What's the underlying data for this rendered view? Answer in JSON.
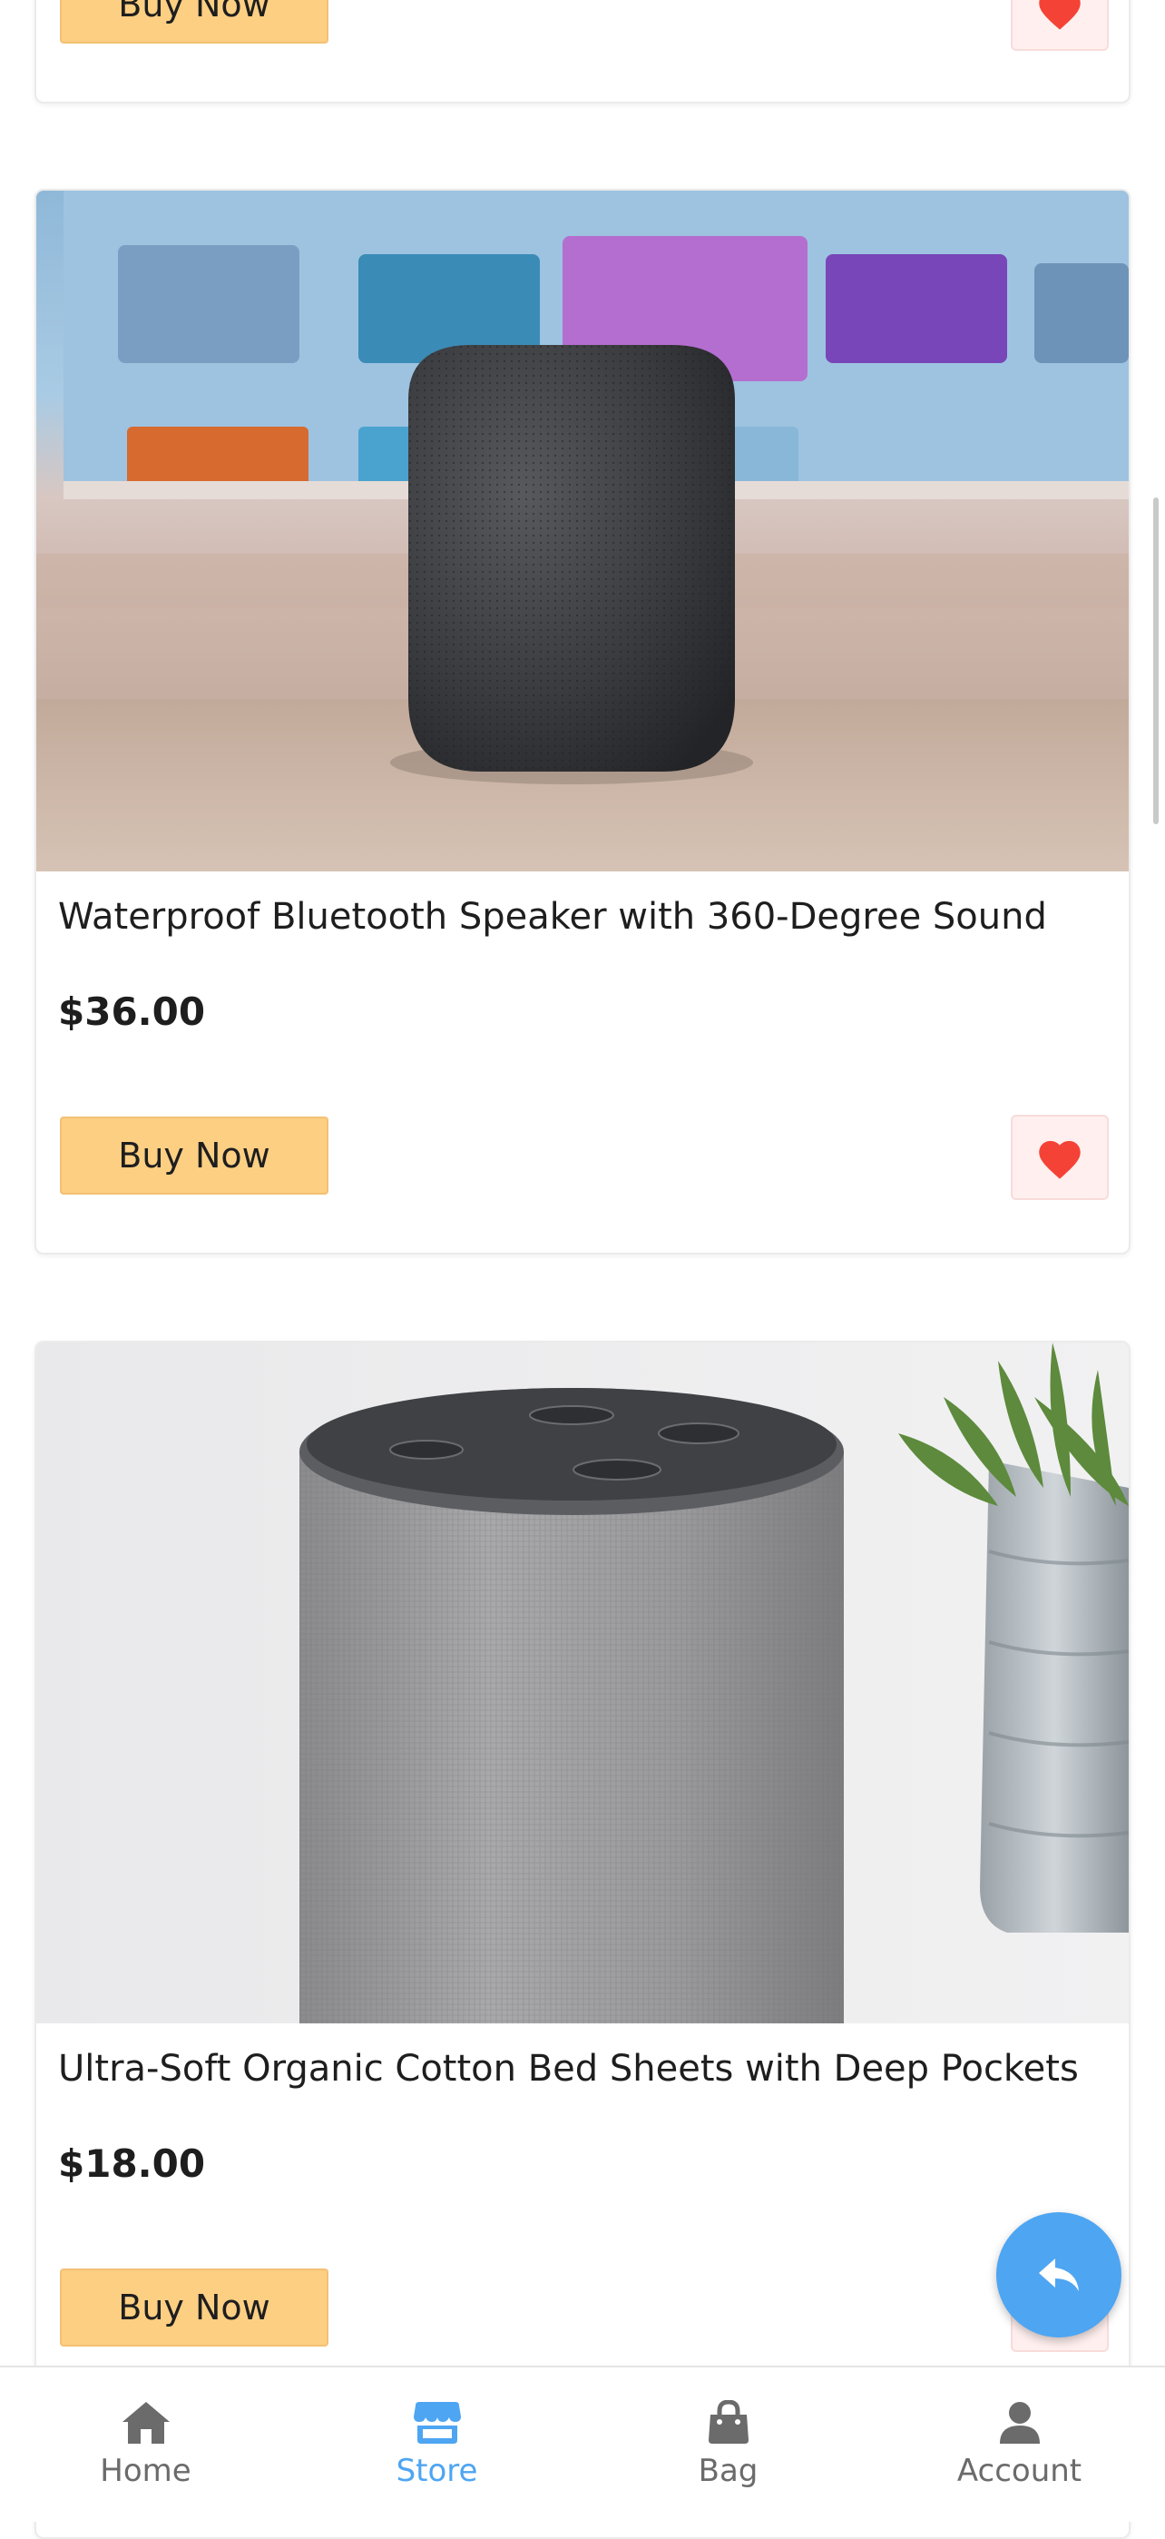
{
  "products": [
    {
      "title": "",
      "price": "",
      "buy_label": "Buy Now"
    },
    {
      "title": "Waterproof Bluetooth Speaker with 360-Degree Sound",
      "price": "$36.00",
      "buy_label": "Buy Now",
      "image_icon": "smart-speaker-dark-photo"
    },
    {
      "title": "Ultra-Soft Organic Cotton Bed Sheets with Deep Pockets",
      "price": "$18.00",
      "buy_label": "Buy Now",
      "image_icon": "smart-speaker-fabric-photo"
    }
  ],
  "tabs": [
    {
      "label": "Home",
      "icon": "home-icon",
      "active": false
    },
    {
      "label": "Store",
      "icon": "store-icon",
      "active": true
    },
    {
      "label": "Bag",
      "icon": "bag-icon",
      "active": false
    },
    {
      "label": "Account",
      "icon": "account-icon",
      "active": false
    }
  ],
  "colors": {
    "accent": "#4ea5f2",
    "buy_button": "#fccf83",
    "heart": "#f44336",
    "fav_bg": "#fff0ef"
  }
}
